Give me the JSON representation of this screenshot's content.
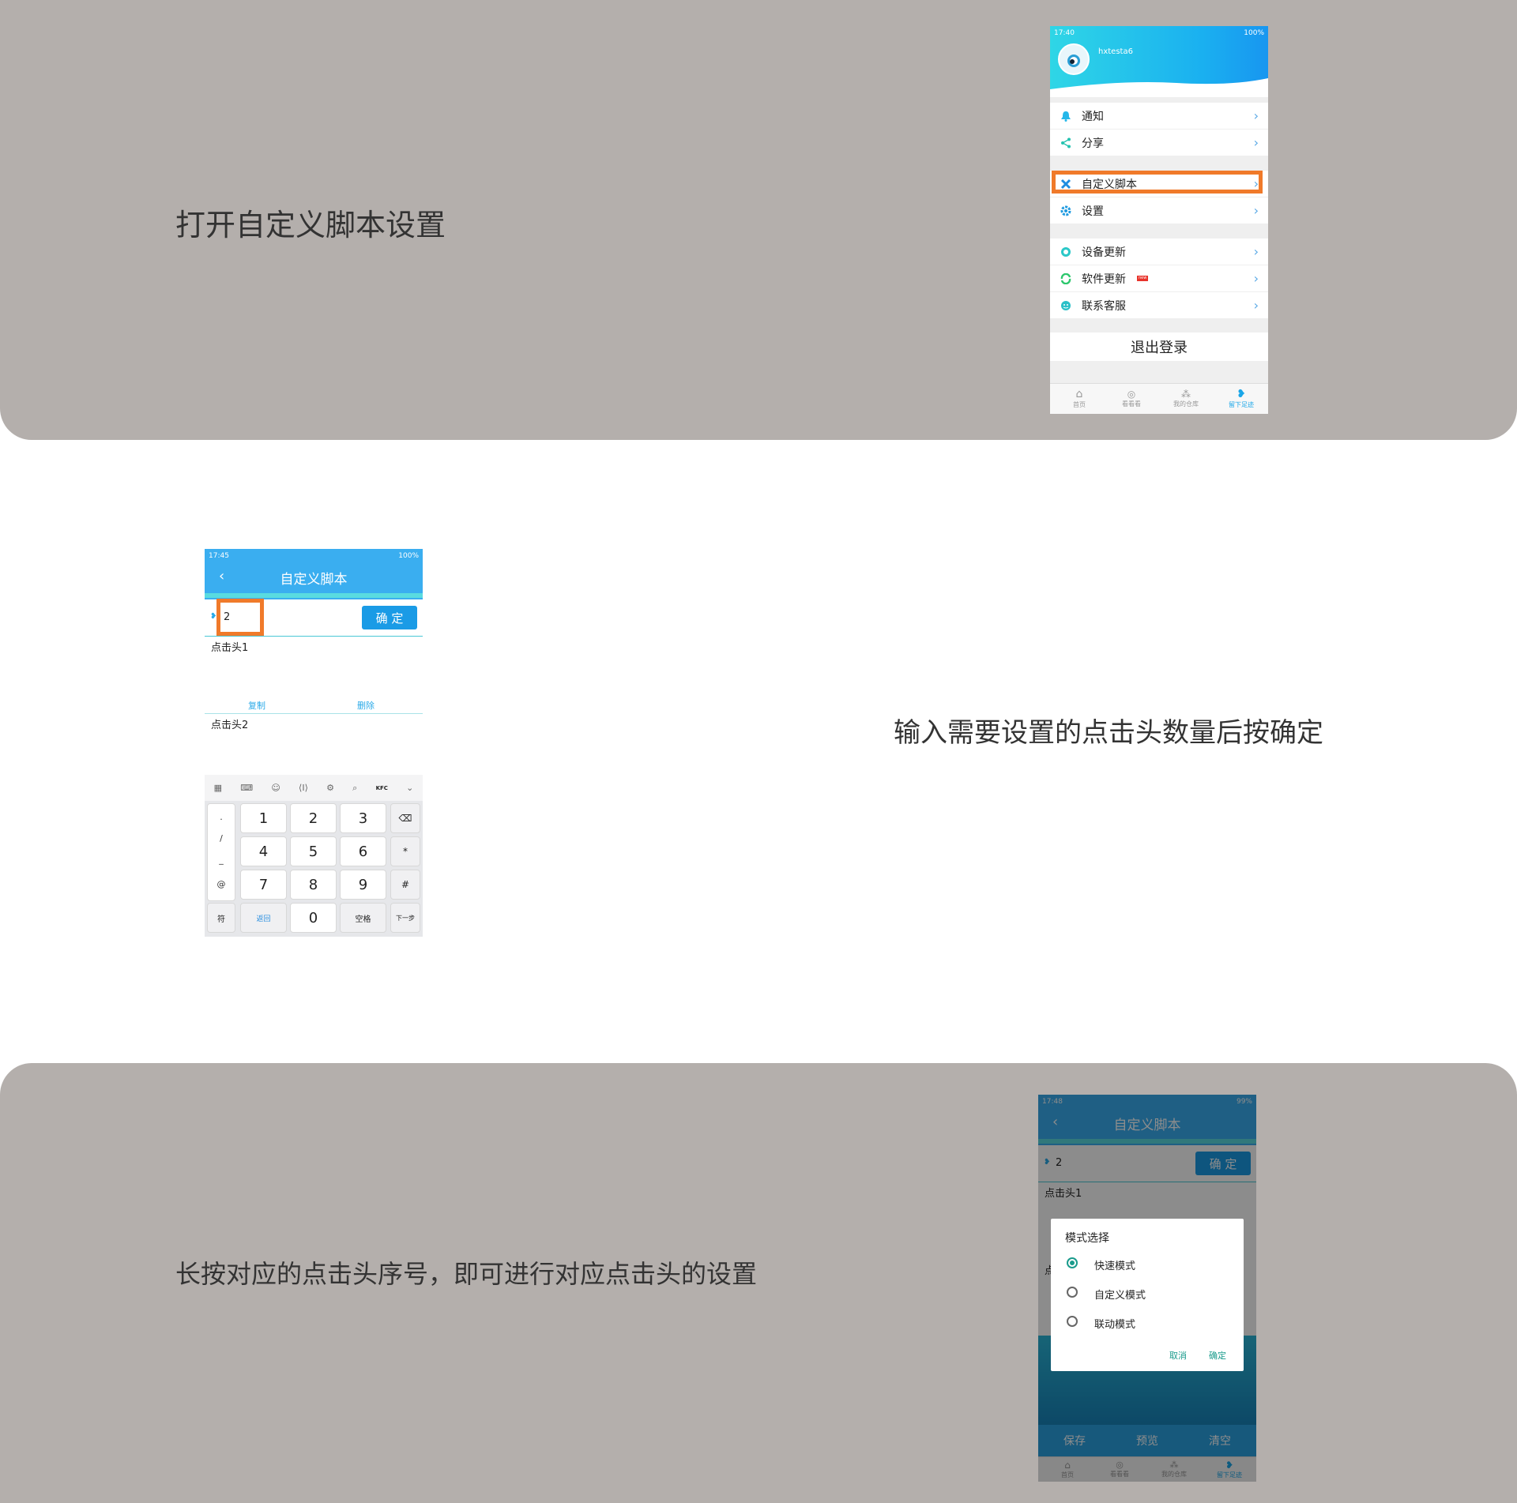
{
  "step1": {
    "caption": "打开自定义脚本设置",
    "status": {
      "time": "17:40",
      "battery": "100%"
    },
    "username": "hxtesta6",
    "menu": [
      {
        "label": "通知",
        "icon": "bell-icon"
      },
      {
        "label": "分享",
        "icon": "share-icon"
      },
      {
        "label": "自定义脚本",
        "icon": "script-icon"
      },
      {
        "label": "设置",
        "icon": "gear-icon"
      },
      {
        "label": "设备更新",
        "icon": "device-update-icon"
      },
      {
        "label": "软件更新",
        "icon": "refresh-icon",
        "badge": "new"
      },
      {
        "label": "联系客服",
        "icon": "support-icon"
      }
    ],
    "logout": "退出登录",
    "tabs": [
      "首页",
      "看看看",
      "我的仓库",
      "留下足迹"
    ]
  },
  "step2": {
    "caption": "输入需要设置的点击头数量后按确定",
    "status": {
      "time": "17:45",
      "battery": "100%"
    },
    "title": "自定义脚本",
    "input_value": "2",
    "confirm": "确 定",
    "head1": "点击头1",
    "head2": "点击头2",
    "copy": "复制",
    "delete": "删除",
    "keyboard": {
      "top_icons": [
        "grid-icon",
        "keyboard-icon",
        "emoji-icon",
        "cursor-icon",
        "settings-icon",
        "search-icon",
        "kfc-icon",
        "collapse-icon"
      ],
      "kfc_label": "KFC",
      "side_keys": [
        ".",
        "/",
        "_",
        "@"
      ],
      "digits": [
        "1",
        "2",
        "3",
        "4",
        "5",
        "6",
        "7",
        "8",
        "9"
      ],
      "right_keys": [
        "⌫",
        "*",
        "#"
      ],
      "bottom": [
        "符",
        "返回",
        "0",
        "空格",
        "下一步"
      ]
    }
  },
  "step3": {
    "caption": "长按对应的点击头序号，即可进行对应点击头的设置",
    "status": {
      "time": "17:48",
      "battery": "99%"
    },
    "title": "自定义脚本",
    "input_value": "2",
    "confirm": "确 定",
    "head1": "点击头1",
    "head2_partial": "点",
    "dialog": {
      "title": "模式选择",
      "options": [
        "快速模式",
        "自定义模式",
        "联动模式"
      ],
      "selected": 0,
      "cancel": "取消",
      "ok": "确定"
    },
    "actions": [
      "保存",
      "预览",
      "清空"
    ],
    "tabs": [
      "首页",
      "看看看",
      "我的仓库",
      "留下足迹"
    ]
  }
}
